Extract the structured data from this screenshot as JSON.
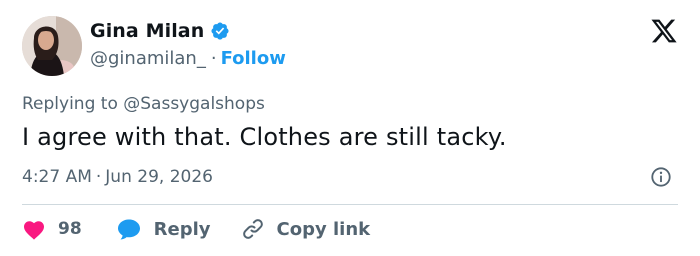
{
  "user": {
    "display_name": "Gina Milan",
    "handle": "@ginamilan_",
    "follow_label": "Follow",
    "separator": "·",
    "verified_color": "#1d9bf0"
  },
  "tweet": {
    "replying_prefix": "Replying to",
    "replying_handle": "@Sassygalshops",
    "text": "I agree with that. Clothes are still tacky.",
    "time": "4:27 AM",
    "date": "Jun 29, 2026",
    "meta_separator": "·"
  },
  "actions": {
    "like_count": "98",
    "reply_label": "Reply",
    "copy_link_label": "Copy link"
  },
  "colors": {
    "like": "#f91880",
    "reply": "#1d9bf0",
    "muted": "#536471",
    "accent": "#1d9bf0"
  },
  "icons": [
    "avatar-image",
    "verified-badge-icon",
    "x-logo-icon",
    "info-icon",
    "heart-icon",
    "reply-bubble-icon",
    "link-icon"
  ]
}
